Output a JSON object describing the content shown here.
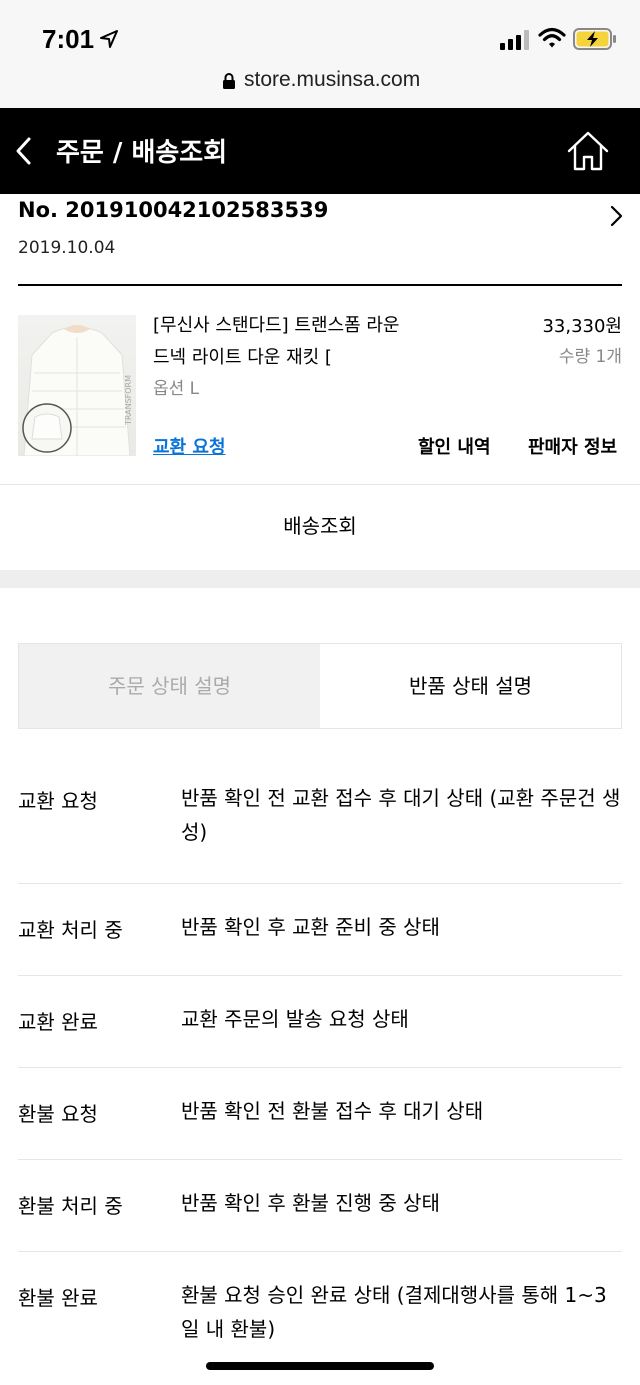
{
  "status_bar": {
    "time": "7:01",
    "url": "store.musinsa.com"
  },
  "header": {
    "title": "주문 / 배송조회"
  },
  "order": {
    "number": "No. 201910042102583539",
    "date": "2019.10.04"
  },
  "product": {
    "name": "[무신사 스탠다드] 트랜스폼 라운드넥 라이트 다운 재킷 [",
    "option": "옵션 L",
    "price": "33,330원",
    "quantity": "수량 1개",
    "image_text": "TRANSFORM",
    "actions": {
      "exchange": "교환 요청",
      "discount": "할인 내역",
      "seller": "판매자 정보"
    }
  },
  "tracking_button": "배송조회",
  "tabs": {
    "order_status": "주문 상태 설명",
    "return_status": "반품 상태 설명",
    "active": "return_status"
  },
  "return_statuses": [
    {
      "label": "교환 요청",
      "description": "반품 확인 전 교환 접수 후 대기 상태 (교환 주문건 생성)"
    },
    {
      "label": "교환 처리 중",
      "description": "반품 확인 후 교환 준비 중 상태"
    },
    {
      "label": "교환 완료",
      "description": "교환 주문의 발송 요청 상태"
    },
    {
      "label": "환불 요청",
      "description": "반품 확인 전 환불 접수 후 대기 상태"
    },
    {
      "label": "환불 처리 중",
      "description": "반품 확인 후 환불 진행 중 상태"
    },
    {
      "label": "환불 완료",
      "description": "환불 요청 승인 완료 상태 (결제대행사를 통해 1~3일 내 환불)"
    }
  ],
  "colors": {
    "header_bg": "#000000",
    "link": "#0a73d9",
    "inactive_tab_bg": "#f1f1f1",
    "battery": "#f5d33b"
  }
}
